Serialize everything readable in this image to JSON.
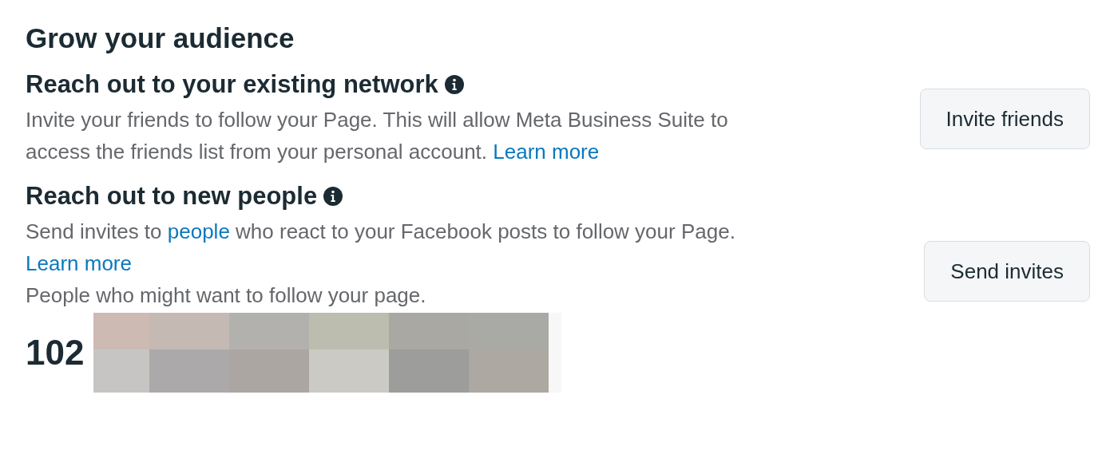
{
  "title": "Grow your audience",
  "sections": [
    {
      "heading": "Reach out to your existing network",
      "paragraphs": [
        [
          {
            "text": "Invite your friends to follow your Page. This will allow Meta Business Suite to access the friends list from your personal account. "
          },
          {
            "text": "Learn more",
            "kind": "link"
          }
        ]
      ],
      "button": "Invite friends"
    },
    {
      "heading": "Reach out to new people",
      "paragraphs": [
        [
          {
            "text": "Send invites to "
          },
          {
            "text": "people",
            "kind": "link"
          },
          {
            "text": " who react to your Facebook posts to follow your Page."
          }
        ],
        [
          {
            "text": "Learn more",
            "kind": "link"
          }
        ],
        [
          {
            "text": "People who might want to follow your page."
          }
        ]
      ],
      "button": "Send invites",
      "count": "102"
    }
  ]
}
